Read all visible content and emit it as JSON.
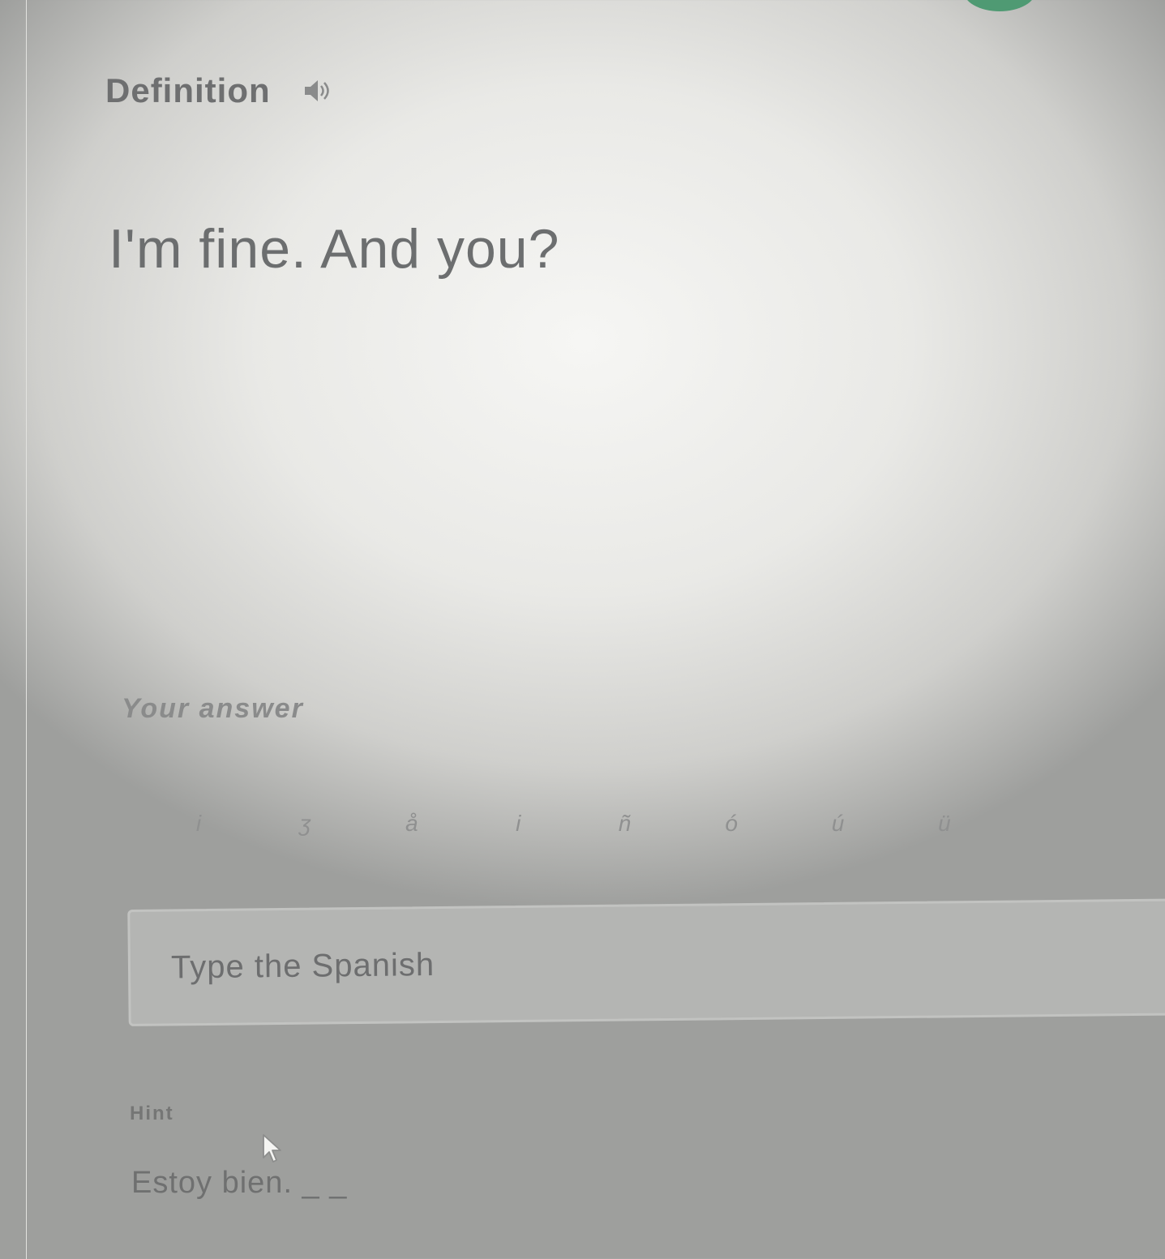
{
  "definition": {
    "label": "Definition",
    "audio_icon": "speaker-icon",
    "term": "I'm fine. And you?"
  },
  "answer": {
    "label": "Your answer",
    "special_chars": [
      "i",
      "ʒ",
      "å",
      "i",
      "ñ",
      "ó",
      "ú",
      "ü"
    ],
    "placeholder": "Type the Spanish",
    "value": ""
  },
  "hint": {
    "label": "Hint",
    "text": "Estoy bien. _ _"
  },
  "colors": {
    "accent": "#4f9a73",
    "text": "#6c6e6f",
    "border": "#c2c3c1"
  },
  "icons": {
    "cursor": "mouse-pointer-icon"
  }
}
